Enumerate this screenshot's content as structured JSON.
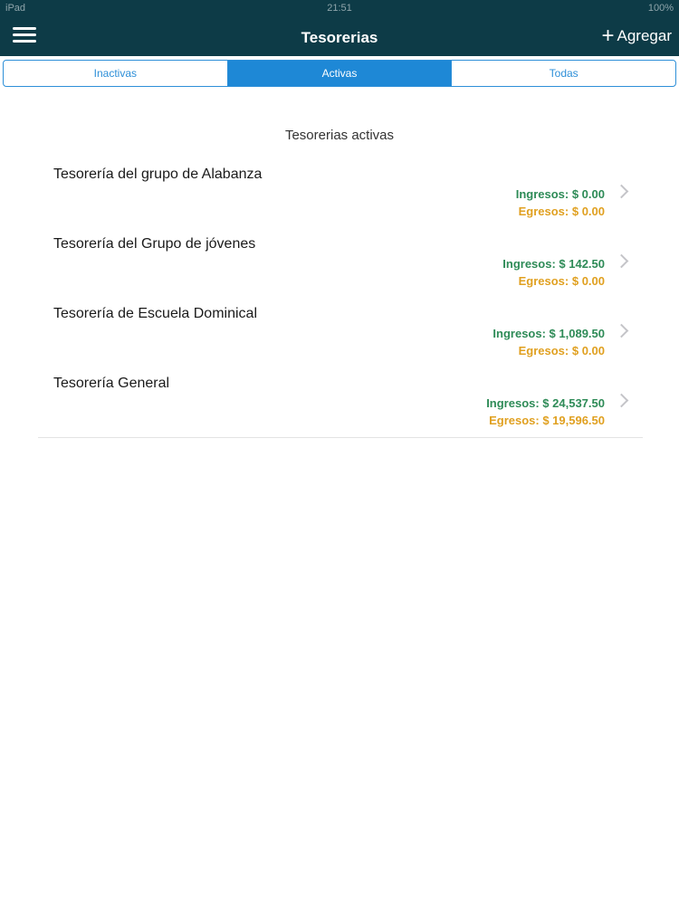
{
  "status_bar": {
    "left": "iPad",
    "time": "21:51",
    "right": "100%"
  },
  "nav": {
    "title": "Tesorerias",
    "add_label": "Agregar"
  },
  "tabs": [
    {
      "label": "Inactivas",
      "active": false
    },
    {
      "label": "Activas",
      "active": true
    },
    {
      "label": "Todas",
      "active": false
    }
  ],
  "section_title": "Tesorerias activas",
  "treasuries": [
    {
      "name": "Tesorería del grupo de Alabanza",
      "ingresos": "Ingresos: $ 0.00",
      "egresos": "Egresos: $ 0.00"
    },
    {
      "name": "Tesorería del Grupo de jóvenes",
      "ingresos": "Ingresos: $ 142.50",
      "egresos": "Egresos: $ 0.00"
    },
    {
      "name": "Tesorería de Escuela Dominical",
      "ingresos": "Ingresos: $ 1,089.50",
      "egresos": "Egresos: $ 0.00"
    },
    {
      "name": "Tesorería General",
      "ingresos": "Ingresos: $ 24,537.50",
      "egresos": "Egresos: $ 19,596.50"
    }
  ],
  "colors": {
    "header": "#0d3b47",
    "accent": "#1e88d6",
    "ingresos": "#2e8b57",
    "egresos": "#e0a020"
  }
}
